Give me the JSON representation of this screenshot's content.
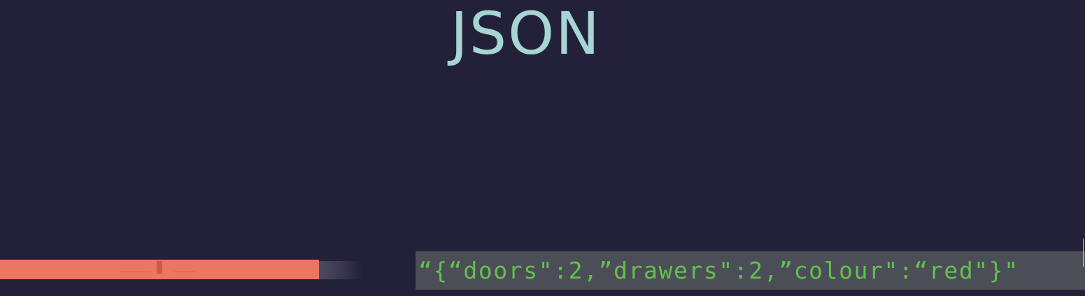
{
  "slide": {
    "title": "JSON",
    "code_string": "“{“doors\":2,”drawers\":2,”colour\":“red\"}\"",
    "colors": {
      "background": "#23213a",
      "title": "#a6d5d4",
      "furniture": "#eb7762",
      "code_box": "#4c4e57",
      "code_text": "#63c14d"
    }
  }
}
